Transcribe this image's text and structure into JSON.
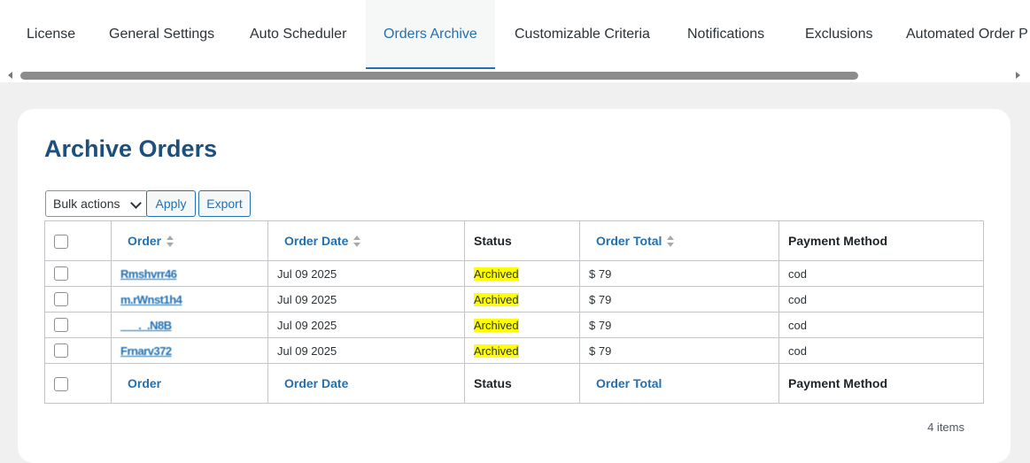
{
  "tabs": [
    {
      "label": "License"
    },
    {
      "label": "General Settings"
    },
    {
      "label": "Auto Scheduler"
    },
    {
      "label": "Orders Archive"
    },
    {
      "label": "Customizable Criteria"
    },
    {
      "label": "Notifications"
    },
    {
      "label": "Exclusions"
    },
    {
      "label": "Automated Order P"
    }
  ],
  "active_tab": "Orders Archive",
  "colors": {
    "accent": "#2271b1",
    "title": "#1d4f7c",
    "highlight": "#ffff00"
  },
  "page": {
    "title": "Archive Orders",
    "bulk_actions_label": "Bulk actions",
    "apply_label": "Apply",
    "export_label": "Export",
    "items_count": "4 items"
  },
  "table": {
    "columns": {
      "order": "Order",
      "order_date": "Order Date",
      "status": "Status",
      "order_total": "Order Total",
      "payment_method": "Payment Method"
    },
    "rows": [
      {
        "order": "Rmshvrr46",
        "date": "Jul 09 2025",
        "status": "Archived",
        "total": "$ 79",
        "payment": "cod"
      },
      {
        "order": "m.rWnst1h4",
        "date": "Jul 09 2025",
        "status": "Archived",
        "total": "$ 79",
        "payment": "cod"
      },
      {
        "order": "___._.N8B",
        "date": "Jul 09 2025",
        "status": "Archived",
        "total": "$ 79",
        "payment": "cod"
      },
      {
        "order": "Frnarv372",
        "date": "Jul 09 2025",
        "status": "Archived",
        "total": "$ 79",
        "payment": "cod"
      }
    ]
  }
}
